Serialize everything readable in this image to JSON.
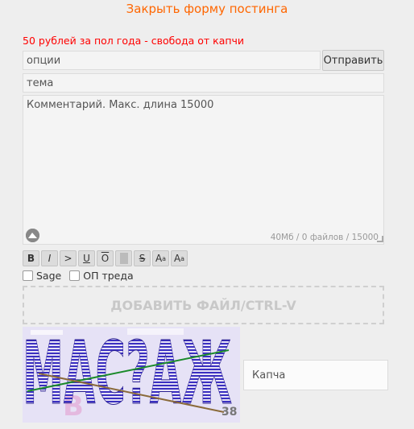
{
  "header": {
    "close_label": "Закрыть форму постинга",
    "promo_text": "50 рублей за пол года - свобода от капчи"
  },
  "form": {
    "options_placeholder": "опции",
    "submit_label": "Отправить",
    "subject_placeholder": "тема",
    "comment_placeholder": "Комментарий. Макс. длина 15000",
    "counter": "40Мб / 0 файлов / 15000"
  },
  "toolbar": {
    "buttons": [
      "B",
      "I",
      ">",
      "U",
      "O",
      "",
      "S",
      "A",
      "A"
    ],
    "sup_a": "a",
    "sub_a": "a"
  },
  "checkboxes": {
    "sage_label": "Sage",
    "op_label": "ОП треда"
  },
  "dropzone": {
    "label": "ДОБАВИТЬ ФАЙЛ/CTRL-V"
  },
  "captcha": {
    "text": "МАС?АЖ",
    "ghost": "В",
    "number": "38",
    "input_placeholder": "Капча"
  },
  "colors": {
    "accent": "#ff6600",
    "promo": "#ff0000",
    "captcha_ink": "#3a2fc0"
  }
}
